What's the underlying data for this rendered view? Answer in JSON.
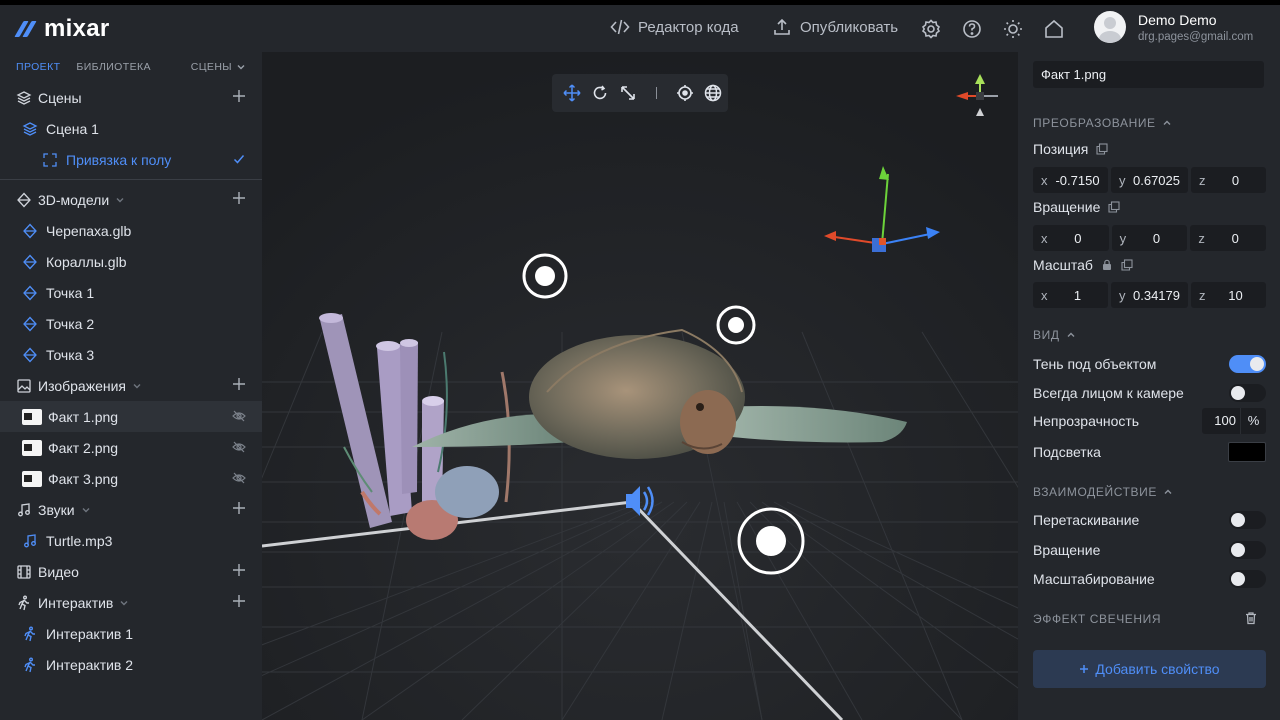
{
  "app": {
    "logo_text": "mixar",
    "accent": "#4f8ef7"
  },
  "header": {
    "code_editor": "Редактор кода",
    "publish": "Опубликовать",
    "icons": [
      "settings-icon",
      "help-icon",
      "theme-icon",
      "home-icon"
    ],
    "user_name": "Demo Demo",
    "user_email": "drg.pages@gmail.com"
  },
  "sidebar": {
    "tabs": [
      "ПРОЕКТ",
      "БИБЛИОТЕКА"
    ],
    "scenes_dropdown": "СЦЕНЫ",
    "scenes_section": "Сцены",
    "scene_1": "Сцена 1",
    "floor_anchor": "Привязка к полу",
    "models_section": "3D-модели",
    "models": [
      "Черепаха.glb",
      "Кораллы.glb",
      "Точка 1",
      "Точка 2",
      "Точка 3"
    ],
    "images_section": "Изображения",
    "images": [
      "Факт 1.png",
      "Факт 2.png",
      "Факт 3.png"
    ],
    "sounds_section": "Звуки",
    "sounds": [
      "Turtle.mp3"
    ],
    "video_section": "Видео",
    "interactive_section": "Интерактив",
    "interactives": [
      "Интерактив 1",
      "Интерактив 2"
    ]
  },
  "inspector": {
    "name": "Факт 1.png",
    "transform_title": "ПРЕОБРАЗОВАНИЕ",
    "position_label": "Позиция",
    "position": {
      "x": "-0.7150",
      "y": "0.67025",
      "z": "0"
    },
    "rotation_label": "Вращение",
    "rotation": {
      "x": "0",
      "y": "0",
      "z": "0"
    },
    "scale_label": "Масштаб",
    "scale": {
      "x": "1",
      "y": "0.34179",
      "z": "10"
    },
    "view_title": "ВИД",
    "shadow_label": "Тень под объектом",
    "shadow_on": true,
    "face_camera_label": "Всегда лицом к камере",
    "face_camera_on": false,
    "opacity_label": "Непрозрачность",
    "opacity_value": "100",
    "opacity_unit": "%",
    "highlight_label": "Подсветка",
    "highlight_color": "#000000",
    "interaction_title": "ВЗАИМОДЕЙСТВИЕ",
    "drag_label": "Перетаскивание",
    "rotate_label": "Вращение",
    "scale_toggle_label": "Масштабирование",
    "glow_title": "ЭФФЕКТ СВЕЧЕНИЯ",
    "add_property": "Добавить свойство"
  },
  "axis_labels": {
    "x": "x",
    "y": "y",
    "z": "z"
  }
}
